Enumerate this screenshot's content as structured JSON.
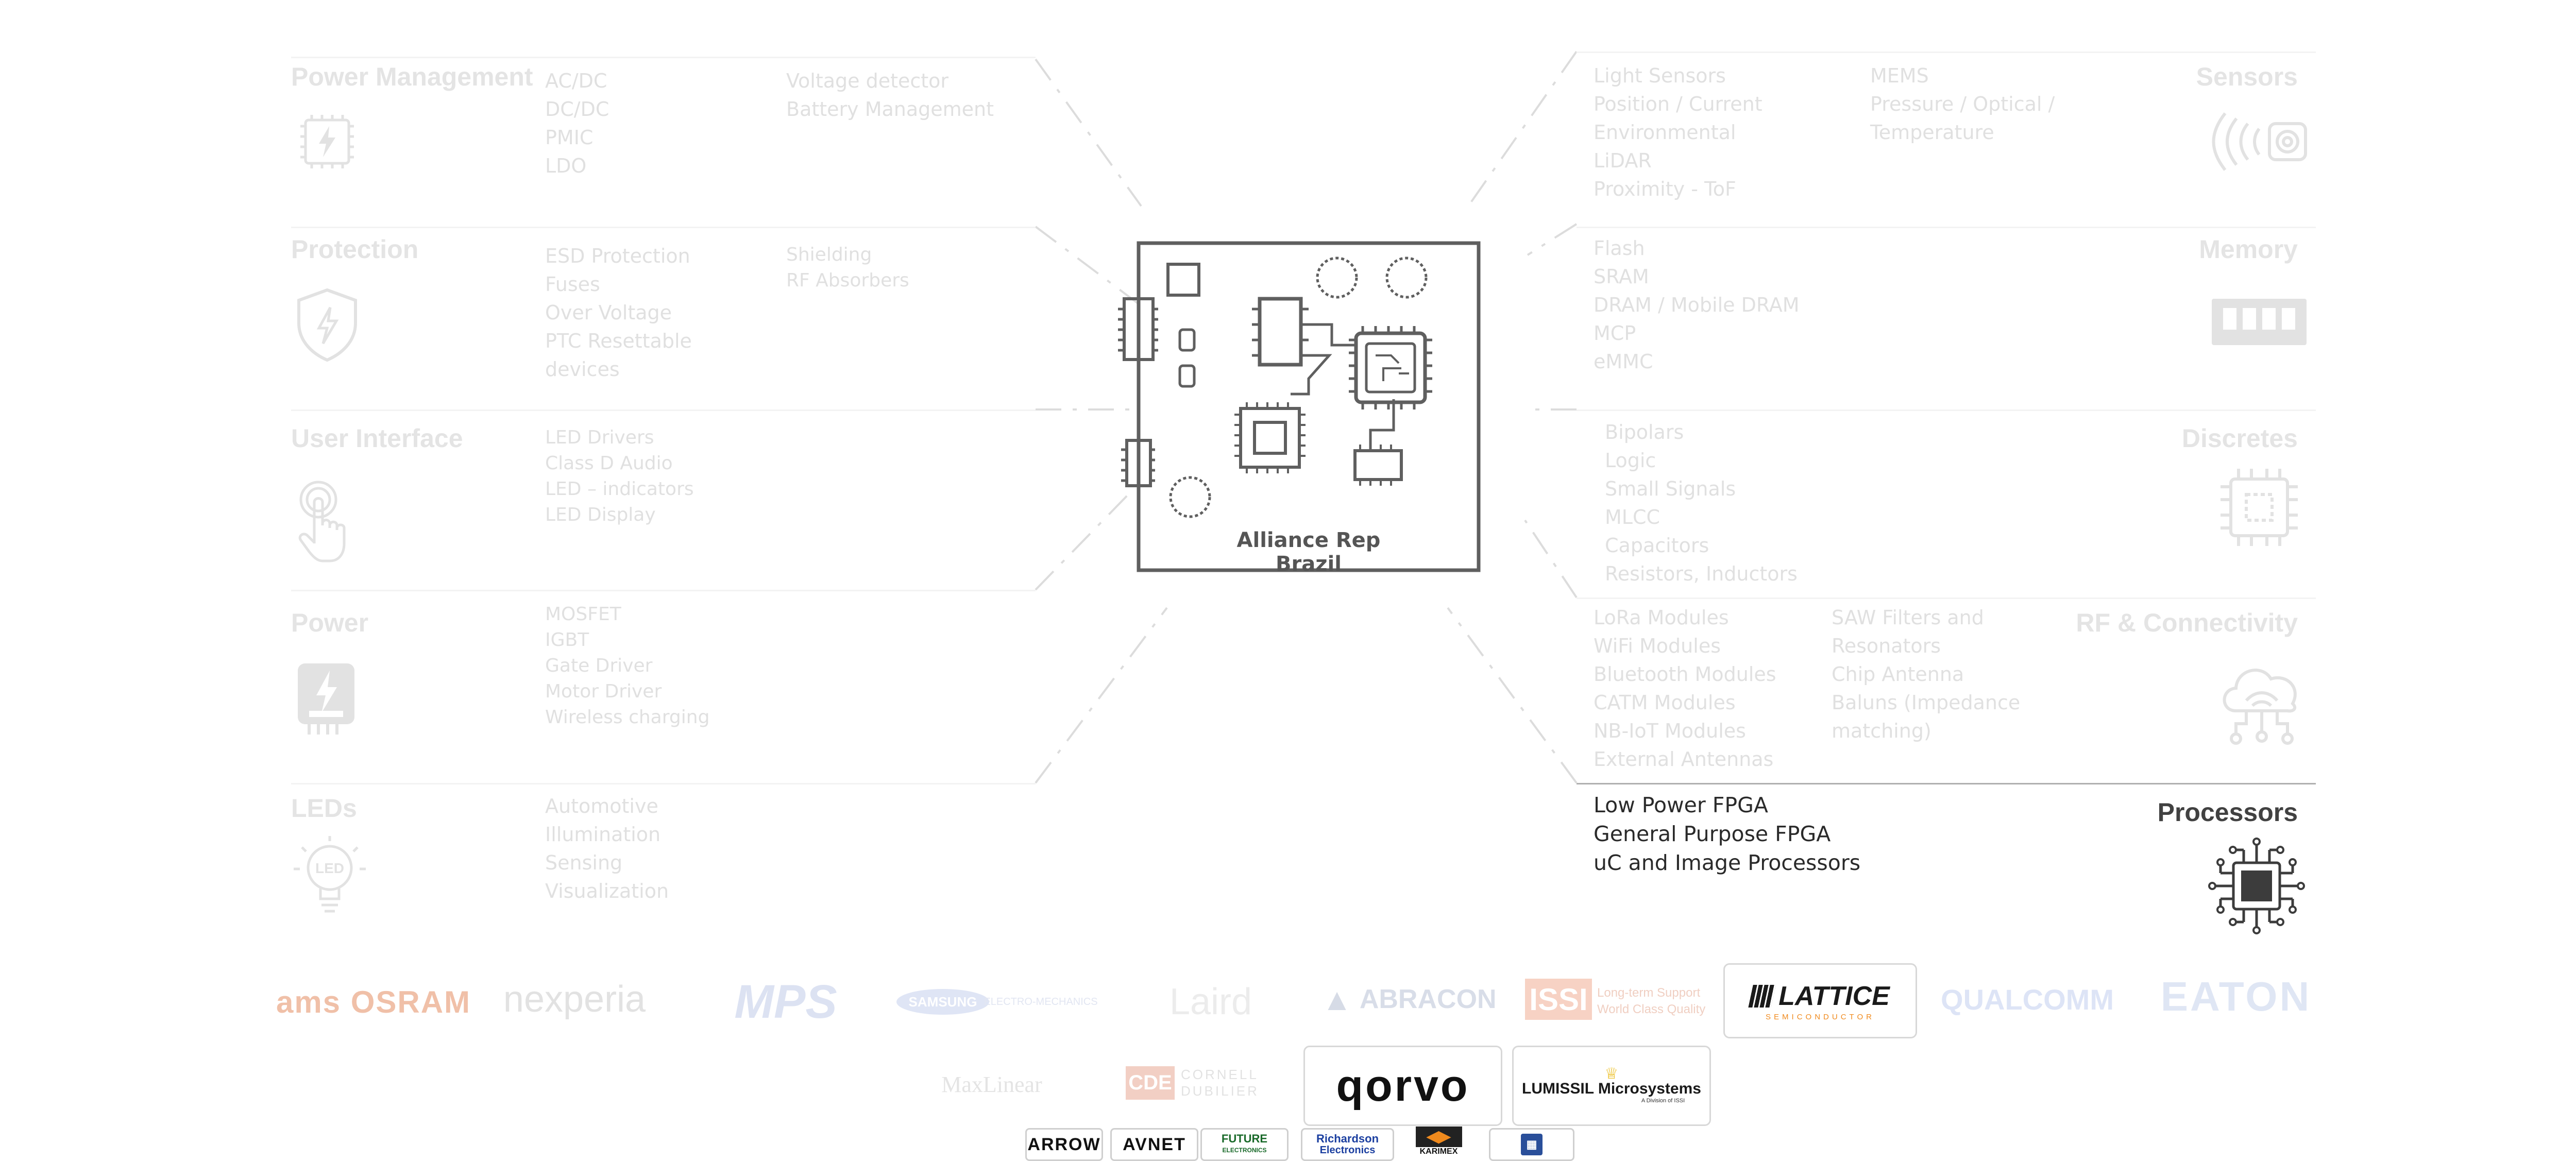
{
  "board": {
    "label": "Alliance Rep Brazil"
  },
  "left_categories": [
    {
      "title": "Power Management",
      "icon": "power-chip-icon",
      "col1": [
        "AC/DC",
        "DC/DC",
        "PMIC",
        "LDO"
      ],
      "col2": [
        "Voltage detector",
        "Battery Management"
      ]
    },
    {
      "title": "Protection",
      "icon": "shield-bolt-icon",
      "col1": [
        "ESD Protection",
        "Fuses",
        "Over Voltage",
        "PTC Resettable",
        "devices"
      ],
      "col2": [
        "Shielding",
        "RF Absorbers"
      ]
    },
    {
      "title": "User Interface",
      "icon": "touch-hand-icon",
      "col1": [
        "LED Drivers",
        "Class D Audio",
        "LED – indicators",
        "LED Display"
      ],
      "col2": []
    },
    {
      "title": "Power",
      "icon": "power-bolt-icon",
      "col1": [
        "MOSFET",
        "IGBT",
        "Gate Driver",
        "Motor Driver",
        "Wireless charging"
      ],
      "col2": []
    },
    {
      "title": "LEDs",
      "icon": "led-bulb-icon",
      "col1": [
        "Automotive",
        "Illumination",
        "Sensing",
        "Visualization"
      ],
      "col2": []
    }
  ],
  "right_categories": [
    {
      "title": "Sensors",
      "icon": "sensor-waves-icon",
      "col1": [
        "Light Sensors",
        "Position / Current",
        "Environmental",
        "LiDAR",
        "Proximity - ToF"
      ],
      "col2": [
        "MEMS",
        "Pressure / Optical /",
        "Temperature"
      ]
    },
    {
      "title": "Memory",
      "icon": "memory-stick-icon",
      "col1": [
        "Flash",
        "SRAM",
        "DRAM / Mobile DRAM",
        "MCP",
        "eMMC"
      ],
      "col2": []
    },
    {
      "title": "Discretes",
      "icon": "discrete-chip-icon",
      "col1": [
        "Bipolars",
        "Logic",
        "Small Signals",
        "MLCC",
        "Capacitors",
        "Resistors, Inductors"
      ],
      "col2": []
    },
    {
      "title": "RF & Connectivity",
      "icon": "cloud-network-icon",
      "col1": [
        "LoRa Modules",
        "WiFi Modules",
        "Bluetooth Modules",
        "CATM Modules",
        "NB-IoT Modules",
        "External Antennas"
      ],
      "col2": [
        "SAW Filters and",
        "Resonators",
        "Chip Antenna",
        "Baluns (Impedance",
        "matching)"
      ]
    },
    {
      "title": "Processors",
      "icon": "processor-chip-icon",
      "col1": [
        "Low Power FPGA",
        "General Purpose FPGA",
        "uC and Image Processors"
      ],
      "col2": []
    }
  ],
  "logos_row1": [
    "ams OSRAM",
    "nexperia",
    "MPS",
    "SAMSUNG",
    "ELECTRO-MECHANICS",
    "Laird",
    "ABRACON",
    "ISSI",
    "Long-term Support",
    "World Class Quality",
    "LATTICE",
    "SEMICONDUCTOR",
    "QUALCOMM",
    "EATON"
  ],
  "logos_row2": [
    "MaxLinear",
    "CDE",
    "CORNELL",
    "DUBILIER",
    "QORVO",
    "LUMISSIL Microsystems",
    "A Division of ISSI"
  ],
  "distributors": [
    "ARROW",
    "AVNET",
    "FUTURE",
    "ELECTRONICS",
    "Richardson",
    "Electronics",
    "KARIMEX"
  ],
  "colors": {
    "active_text": "#2a2a2a",
    "faded_text": "#e0e0e0",
    "board_stroke": "#606060",
    "lattice_orange": "#f08a1d",
    "samsung_blue": "#1b3fa0"
  }
}
